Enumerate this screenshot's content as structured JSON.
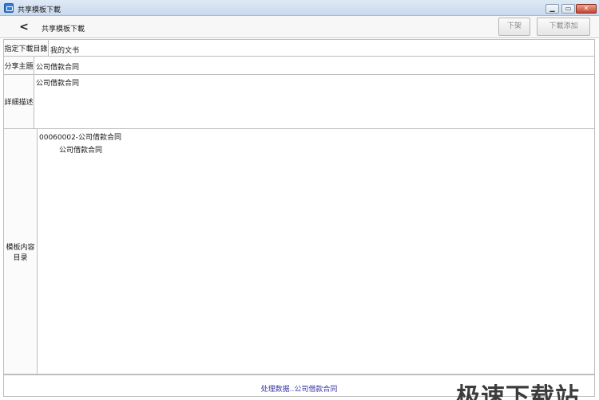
{
  "window": {
    "title": "共享模板下載",
    "min_icon": "minimize-icon",
    "max_icon": "maximize-icon",
    "close_icon": "close-icon",
    "min_glyph": "▁",
    "max_glyph": "▭",
    "close_glyph": "✕"
  },
  "toolbar": {
    "back_glyph": "<",
    "page_title": "共享模板下載",
    "unlist_label": "下架",
    "download_add_label": "下載添加"
  },
  "form": {
    "download_dir_label": "指定下載目錄",
    "download_dir_value": "我的文书",
    "topic_label": "分享主題",
    "topic_value": "公司借款合同",
    "detail_label": "詳細描述",
    "detail_value": "公司借款合同",
    "contents_label_line1": "模板内容",
    "contents_label_line2": "目录",
    "contents_tree": [
      "00060002-公司借款合同",
      "公司借款合同"
    ]
  },
  "status": {
    "text": "处理数据..公司借款合同",
    "watermark": "极速下载站"
  },
  "colors": {
    "status_text": "#3a3aa8",
    "titlebar": "#c9d9ee",
    "close_button": "#c7452c"
  }
}
